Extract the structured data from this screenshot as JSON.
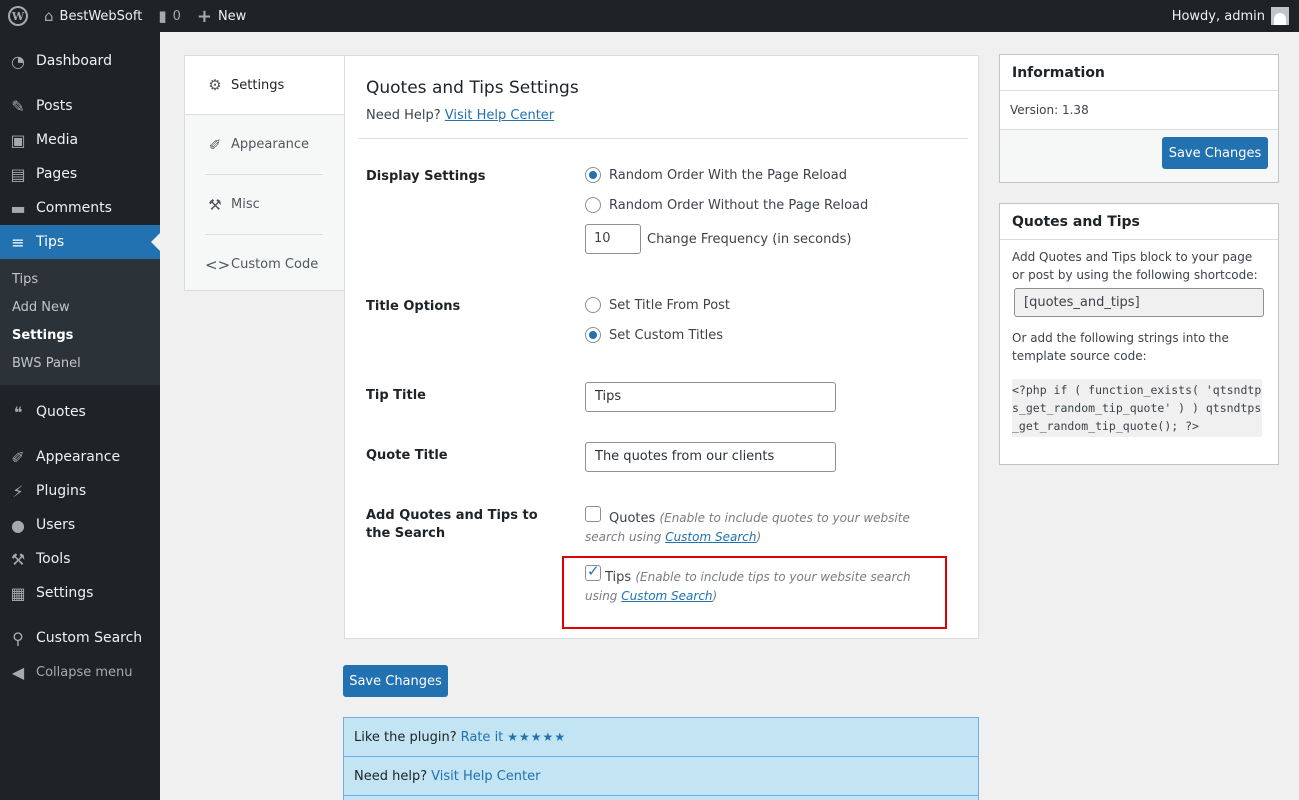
{
  "adminbar": {
    "site_name": "BestWebSoft",
    "comments_count": "0",
    "new_label": "New",
    "howdy": "Howdy, admin"
  },
  "sidebar": {
    "items": [
      {
        "label": "Dashboard",
        "icon": "dashboard-icon"
      },
      {
        "label": "Posts",
        "icon": "pin-icon"
      },
      {
        "label": "Media",
        "icon": "media-icon"
      },
      {
        "label": "Pages",
        "icon": "pages-icon"
      },
      {
        "label": "Comments",
        "icon": "comments-icon"
      },
      {
        "label": "Tips",
        "icon": "tips-icon"
      },
      {
        "label": "Quotes",
        "icon": "quote-icon"
      },
      {
        "label": "Appearance",
        "icon": "brush-icon"
      },
      {
        "label": "Plugins",
        "icon": "plugin-icon"
      },
      {
        "label": "Users",
        "icon": "user-icon"
      },
      {
        "label": "Tools",
        "icon": "wrench-icon"
      },
      {
        "label": "Settings",
        "icon": "settings-icon"
      },
      {
        "label": "Custom Search",
        "icon": "search-icon"
      },
      {
        "label": "Collapse menu",
        "icon": "collapse-icon"
      }
    ],
    "submenu": [
      "Tips",
      "Add New",
      "Settings",
      "BWS Panel"
    ]
  },
  "tabs": [
    "Settings",
    "Appearance",
    "Misc",
    "Custom Code"
  ],
  "main": {
    "title": "Quotes and Tips Settings",
    "need_help": "Need Help?",
    "help_link": "Visit Help Center",
    "display_label": "Display Settings",
    "display_opt1": "Random Order With the Page Reload",
    "display_opt2": "Random Order Without the Page Reload",
    "frequency_value": "10",
    "frequency_label": "Change Frequency (in seconds)",
    "title_options_label": "Title Options",
    "title_opt1": "Set Title From Post",
    "title_opt2": "Set Custom Titles",
    "tip_title_label": "Tip Title",
    "tip_title_value": "Tips",
    "quote_title_label": "Quote Title",
    "quote_title_value": "The quotes from our clients",
    "search_label": "Add Quotes and Tips to the Search",
    "quotes_check": "Quotes",
    "quotes_desc": "(Enable to include quotes to your website search using",
    "tips_check": "Tips",
    "tips_desc": "(Enable to include tips to your website search using",
    "custom_search_link": "Custom Search",
    "desc_close": ")"
  },
  "save_label": "Save Changes",
  "notice": {
    "like": "Like the plugin?",
    "rate": "Rate it",
    "stars": "★★★★★",
    "need_help": "Need help?",
    "help_link": "Visit Help Center"
  },
  "info_box": {
    "title": "Information",
    "version": "Version: 1.38"
  },
  "qt_box": {
    "title": "Quotes and Tips",
    "text1": "Add Quotes and Tips block to your page or post by using the following shortcode:",
    "shortcode": "[quotes_and_tips]",
    "text2": "Or add the following strings into the template source code:",
    "code": "<?php if ( function_exists( 'qtsndtps_get_random_tip_quote' ) ) qtsndtps_get_random_tip_quote(); ?>"
  }
}
